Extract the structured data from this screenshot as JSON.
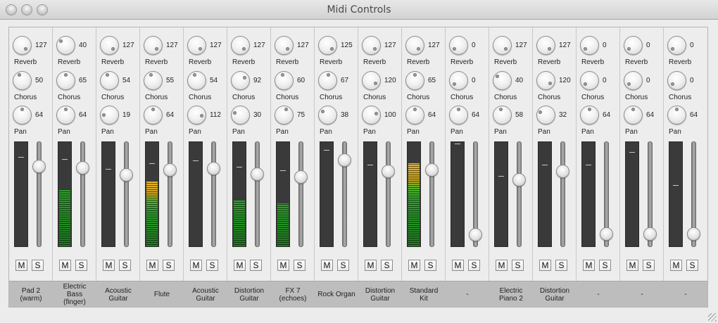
{
  "window": {
    "title": "Midi Controls"
  },
  "knob_labels": {
    "reverb": "Reverb",
    "chorus": "Chorus",
    "pan": "Pan"
  },
  "buttons": {
    "mute": "M",
    "solo": "S"
  },
  "colors": {
    "meter_green": "#2f9f2f",
    "meter_orange": "#e8b52a",
    "name_bar": "#bdbdbd"
  },
  "channels": [
    {
      "name": "Pad 2\n(warm)",
      "reverb": "127",
      "chorus": "50",
      "pan": "64",
      "level": 0.0,
      "fader": 0.8,
      "peak": 0.86
    },
    {
      "name": "Electric\nBass\n(finger)",
      "reverb": "40",
      "chorus": "65",
      "pan": "64",
      "level": 0.55,
      "fader": 0.79,
      "peak": 0.84
    },
    {
      "name": "Acoustic\nGuitar",
      "reverb": "127",
      "chorus": "54",
      "pan": "19",
      "level": 0.0,
      "fader": 0.71,
      "peak": 0.75
    },
    {
      "name": "Flute",
      "reverb": "127",
      "chorus": "55",
      "pan": "64",
      "level": 0.62,
      "fader": 0.76,
      "peak": 0.8
    },
    {
      "name": "Acoustic\nGuitar",
      "reverb": "127",
      "chorus": "54",
      "pan": "112",
      "level": 0.0,
      "fader": 0.78,
      "peak": 0.83
    },
    {
      "name": "Distortion\nGuitar",
      "reverb": "127",
      "chorus": "92",
      "pan": "30",
      "level": 0.44,
      "fader": 0.72,
      "peak": 0.77
    },
    {
      "name": "FX 7\n(echoes)",
      "reverb": "127",
      "chorus": "60",
      "pan": "75",
      "level": 0.41,
      "fader": 0.69,
      "peak": 0.73
    },
    {
      "name": "Rock Organ",
      "reverb": "125",
      "chorus": "67",
      "pan": "38",
      "level": 0.0,
      "fader": 0.87,
      "peak": 0.93
    },
    {
      "name": "Distortion\nGuitar",
      "reverb": "127",
      "chorus": "120",
      "pan": "100",
      "level": 0.0,
      "fader": 0.75,
      "peak": 0.79
    },
    {
      "name": "Standard\nKit",
      "reverb": "127",
      "chorus": "65",
      "pan": "64",
      "level": 0.8,
      "fader": 0.76,
      "peak": 0.8
    },
    {
      "name": "-",
      "reverb": "0",
      "chorus": "0",
      "pan": "64",
      "level": 0.0,
      "fader": 0.06,
      "peak": 0.99
    },
    {
      "name": "Electric\nPiano 2",
      "reverb": "127",
      "chorus": "40",
      "pan": "58",
      "level": 0.0,
      "fader": 0.66,
      "peak": 0.68
    },
    {
      "name": "Distortion\nGuitar",
      "reverb": "127",
      "chorus": "120",
      "pan": "32",
      "level": 0.0,
      "fader": 0.75,
      "peak": 0.79
    },
    {
      "name": "-",
      "reverb": "0",
      "chorus": "0",
      "pan": "64",
      "level": 0.0,
      "fader": 0.07,
      "peak": 0.79
    },
    {
      "name": "-",
      "reverb": "0",
      "chorus": "0",
      "pan": "64",
      "level": 0.0,
      "fader": 0.07,
      "peak": 0.91
    },
    {
      "name": "-",
      "reverb": "0",
      "chorus": "0",
      "pan": "64",
      "level": 0.0,
      "fader": 0.07,
      "peak": 0.59
    }
  ]
}
